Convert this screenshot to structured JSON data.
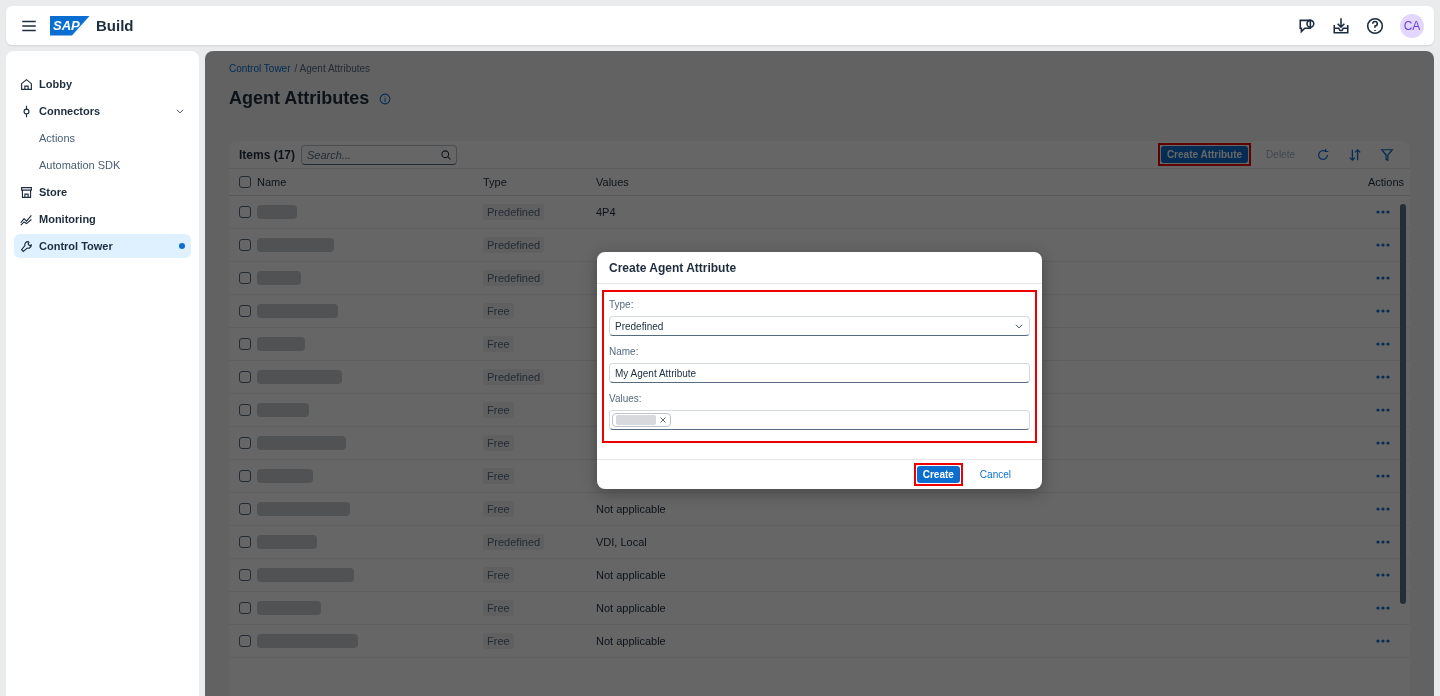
{
  "header": {
    "logo": "SAP",
    "product": "Build",
    "avatar": "CA"
  },
  "sidebar": {
    "items": [
      {
        "label": "Lobby",
        "selected": false
      },
      {
        "label": "Connectors",
        "selected": false,
        "expanded": true,
        "children": [
          {
            "label": "Actions",
            "selected": false
          },
          {
            "label": "Automation SDK",
            "selected": false
          }
        ]
      },
      {
        "label": "Store",
        "selected": false
      },
      {
        "label": "Monitoring",
        "selected": false
      },
      {
        "label": "Control Tower",
        "selected": true
      }
    ]
  },
  "breadcrumb": [
    {
      "label": "Control Tower",
      "link": true
    },
    {
      "label": "/ Agent Attributes",
      "link": false
    }
  ],
  "title": "Agent Attributes",
  "table": {
    "count_label": "Items (17)",
    "all_selected": false,
    "search": {
      "placeholder": "Search..."
    },
    "toolbar": [
      {
        "label": "Create Attribute",
        "kind": "primary",
        "disabled": false,
        "highlighted": true
      },
      {
        "label": "Delete",
        "kind": "text",
        "disabled": true,
        "highlighted": false
      },
      {
        "kind": "refresh"
      },
      {
        "kind": "sort"
      },
      {
        "kind": "filter"
      }
    ],
    "columns": [
      "Name",
      "Type",
      "Values",
      "Actions"
    ],
    "rows": [
      {
        "selected": false,
        "type": "Predefined",
        "values": "4P4"
      },
      {
        "selected": false,
        "type": "Predefined"
      },
      {
        "selected": false,
        "type": "Predefined"
      },
      {
        "selected": false,
        "type": "Free"
      },
      {
        "selected": false,
        "type": "Free"
      },
      {
        "selected": false,
        "type": "Predefined"
      },
      {
        "selected": false,
        "type": "Free"
      },
      {
        "selected": false,
        "type": "Free"
      },
      {
        "selected": false,
        "type": "Free"
      },
      {
        "selected": false,
        "type": "Free",
        "values": "Not applicable"
      },
      {
        "selected": false,
        "type": "Predefined",
        "values": "VDI, Local"
      },
      {
        "selected": false,
        "type": "Free",
        "values": "Not applicable"
      },
      {
        "selected": false,
        "type": "Free",
        "values": "Not applicable"
      },
      {
        "selected": false,
        "type": "Free",
        "values": "Not applicable"
      }
    ]
  },
  "dialog": {
    "title": "Create Agent Attribute",
    "highlighted": true,
    "fields": [
      {
        "label": "Type:",
        "kind": "select",
        "value": "Predefined"
      },
      {
        "label": "Name:",
        "kind": "text",
        "value": "My Agent Attribute"
      },
      {
        "label": "Values:",
        "kind": "tokens"
      }
    ],
    "buttons": [
      {
        "label": "Create",
        "kind": "primary",
        "highlighted": true
      },
      {
        "label": "Cancel",
        "kind": "text",
        "highlighted": false
      }
    ]
  }
}
